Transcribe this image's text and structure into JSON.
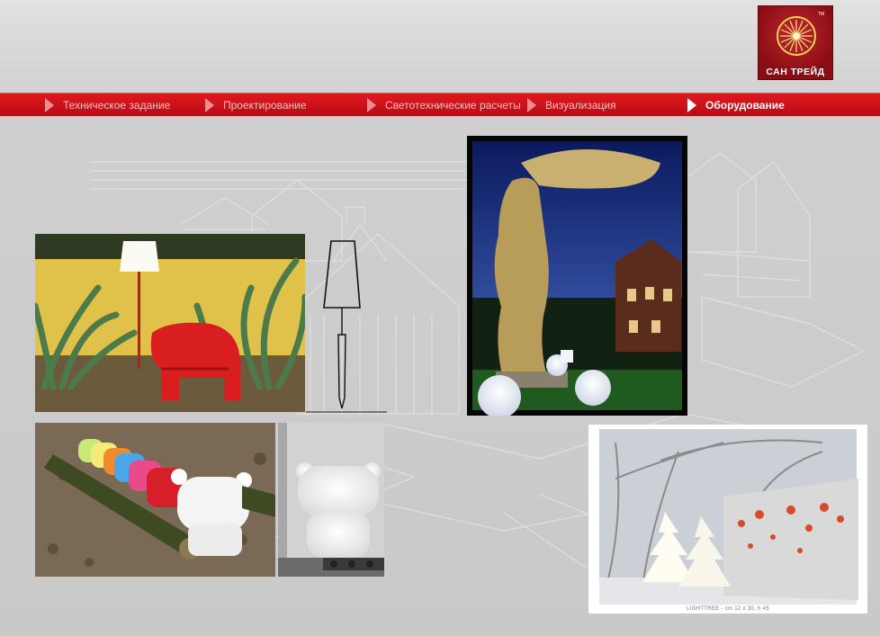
{
  "logo": {
    "name": "САН ТРЕЙД",
    "tm": "TM"
  },
  "nav": {
    "items": [
      {
        "label": "Техническое задание"
      },
      {
        "label": "Проектирование"
      },
      {
        "label": "Светотехнические расчеты"
      },
      {
        "label": "Визуализация"
      },
      {
        "label": "Оборудование"
      }
    ],
    "active_index": 4
  },
  "gallery": {
    "lighttree_caption": "LIGHTTREE - cm 12 x 30, h 45"
  },
  "colors": {
    "accent_red": "#d4141c",
    "nav_inactive_text": "#f4c2c4",
    "nav_active_text": "#ffffff",
    "background": "#cfcfcf"
  }
}
